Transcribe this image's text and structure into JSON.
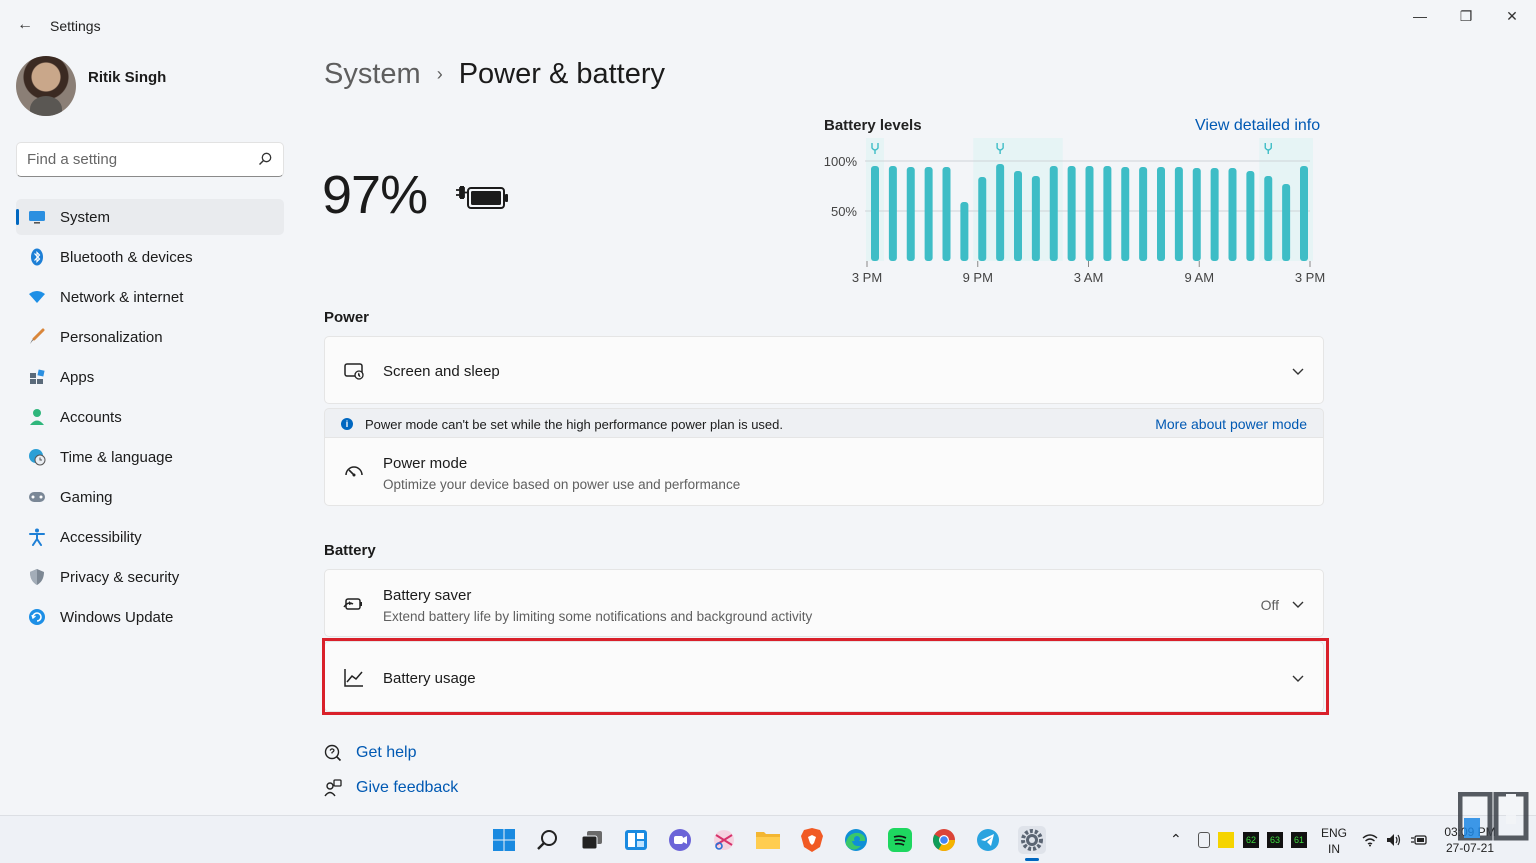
{
  "window": {
    "title": "Settings",
    "back_glyph": "←",
    "minimize_glyph": "—",
    "maximize_glyph": "❐",
    "close_glyph": "✕"
  },
  "profile": {
    "name": "Ritik Singh"
  },
  "search": {
    "placeholder": "Find a setting",
    "icon": "search-icon"
  },
  "sidebar": {
    "items": [
      {
        "label": "System",
        "icon": "monitor-icon",
        "active": true
      },
      {
        "label": "Bluetooth & devices",
        "icon": "bluetooth-icon"
      },
      {
        "label": "Network & internet",
        "icon": "wifi-icon"
      },
      {
        "label": "Personalization",
        "icon": "brush-icon"
      },
      {
        "label": "Apps",
        "icon": "apps-icon"
      },
      {
        "label": "Accounts",
        "icon": "person-icon"
      },
      {
        "label": "Time & language",
        "icon": "globe-clock-icon"
      },
      {
        "label": "Gaming",
        "icon": "gamepad-icon"
      },
      {
        "label": "Accessibility",
        "icon": "accessibility-icon"
      },
      {
        "label": "Privacy & security",
        "icon": "shield-icon"
      },
      {
        "label": "Windows Update",
        "icon": "update-icon"
      }
    ]
  },
  "breadcrumb": {
    "parent": "System",
    "separator": "›",
    "current": "Power & battery"
  },
  "battery": {
    "percent_label": "97%",
    "charging": true
  },
  "chart_data": {
    "type": "bar",
    "title": "Battery levels",
    "link_label": "View detailed info",
    "y_ticks": [
      "100%",
      "50%"
    ],
    "ylim": [
      0,
      100
    ],
    "x_tick_labels": [
      "3 PM",
      "9 PM",
      "3 AM",
      "9 AM",
      "3 PM"
    ],
    "values": [
      95,
      95,
      94,
      94,
      94,
      59,
      84,
      97,
      90,
      85,
      95,
      95,
      95,
      95,
      94,
      94,
      94,
      94,
      93,
      93,
      93,
      90,
      85,
      77,
      95
    ],
    "charging_marker_indices": [
      0,
      7,
      22
    ],
    "bar_color": "#3ebdc6",
    "grid": true
  },
  "power": {
    "section_label": "Power",
    "screen_sleep": {
      "title": "Screen and sleep"
    },
    "info": {
      "text": "Power mode can't be set while the high performance power plan is used.",
      "link": "More about power mode"
    },
    "power_mode": {
      "title": "Power mode",
      "subtitle": "Optimize your device based on power use and performance"
    }
  },
  "battery_section": {
    "section_label": "Battery",
    "saver": {
      "title": "Battery saver",
      "subtitle": "Extend battery life by limiting some notifications and background activity",
      "value": "Off"
    },
    "usage": {
      "title": "Battery usage"
    }
  },
  "help": {
    "get_help": "Get help",
    "give_feedback": "Give feedback"
  },
  "taskbar": {
    "language_top": "ENG",
    "language_bottom": "IN",
    "time": "03:09 PM",
    "date": "27-07-21",
    "tray_badges": [
      "62",
      "63",
      "61"
    ],
    "accent": "#0067c0"
  }
}
